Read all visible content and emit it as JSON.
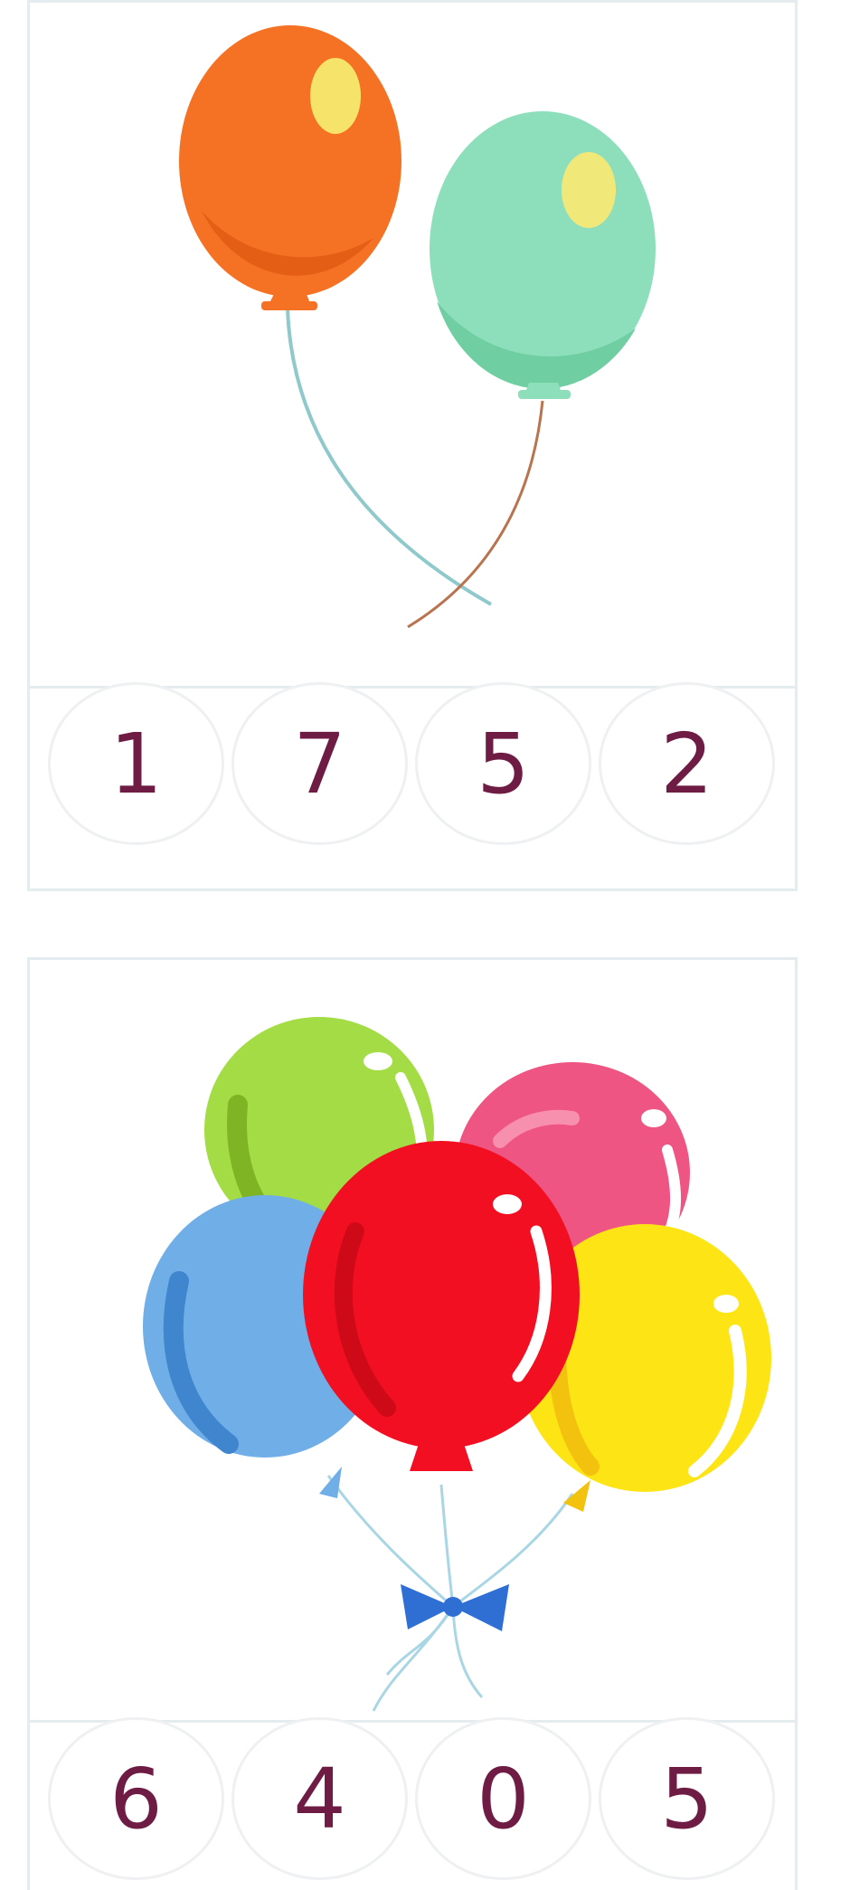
{
  "puzzles": [
    {
      "image": "two-balloons",
      "balloon_colors": [
        "#f57124",
        "#8ddfbc"
      ],
      "options": [
        "1",
        "7",
        "5",
        "2"
      ]
    },
    {
      "image": "balloon-bunch",
      "balloon_colors": [
        "#a3dc45",
        "#ee5582",
        "#6faee6",
        "#f20f22",
        "#fde515"
      ],
      "options": [
        "6",
        "4",
        "0",
        "5"
      ]
    }
  ]
}
